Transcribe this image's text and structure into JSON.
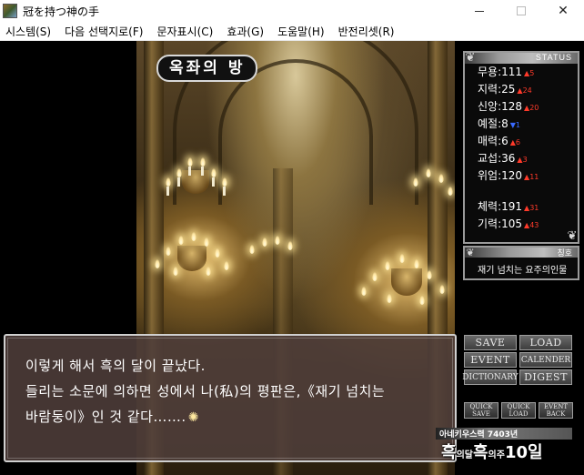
{
  "window": {
    "title": "冠を持つ神の手",
    "minimize": "—",
    "maximize": "☐",
    "close": "✕"
  },
  "menu": [
    "시스템(S)",
    "다음 선택지로(F)",
    "문자표시(C)",
    "효과(G)",
    "도움말(H)",
    "반전리셋(R)"
  ],
  "scene": {
    "location": "옥좌의 방"
  },
  "status": {
    "header": "STATUS",
    "stats": [
      {
        "label": "무용:",
        "value": "111",
        "delta": "5",
        "dir": "up"
      },
      {
        "label": "지력:",
        "value": "25",
        "delta": "24",
        "dir": "up"
      },
      {
        "label": "신앙:",
        "value": "128",
        "delta": "20",
        "dir": "up"
      },
      {
        "label": "예절:",
        "value": "8",
        "delta": "1",
        "dir": "down"
      },
      {
        "label": "매력:",
        "value": "6",
        "delta": "6",
        "dir": "up"
      },
      {
        "label": "교섭:",
        "value": "36",
        "delta": "3",
        "dir": "up"
      },
      {
        "label": "위엄:",
        "value": "120",
        "delta": "11",
        "dir": "up"
      }
    ],
    "stats2": [
      {
        "label": "체력:",
        "value": "191",
        "delta": "31",
        "dir": "up"
      },
      {
        "label": "기력:",
        "value": "105",
        "delta": "43",
        "dir": "up"
      }
    ]
  },
  "title_panel": {
    "header": "칭호",
    "value": "재기 넘치는 요주의인물"
  },
  "message": {
    "lines": [
      "이렇게 해서 흑의 달이 끝났다.",
      "들리는 소문에 의하면 성에서 나(私)의 평판은,《재기 넘치는",
      "바람둥이》인 것 같다……."
    ]
  },
  "buttons": {
    "save": "SAVE",
    "load": "LOAD",
    "event": "EVENT",
    "calender": "CALENDER",
    "dictionary": "DICTIONARY",
    "digest": "DIGEST",
    "quick_save_1": "QUICK",
    "quick_save_2": "SAVE",
    "quick_load_1": "QUICK",
    "quick_load_2": "LOAD",
    "event_back_1": "EVENT",
    "event_back_2": "BACK"
  },
  "date": {
    "year_line": "아네키우스력 7403년",
    "part1": "흑",
    "part2": "의 ",
    "part3": "달",
    "part4": "흑",
    "part5": "의 ",
    "part6": "주",
    "part7": "10",
    "part8": "일"
  },
  "colors": {
    "stat_up": "#ff3a2a",
    "stat_down": "#3a6aff",
    "message_bg": "#4e3e3a"
  }
}
